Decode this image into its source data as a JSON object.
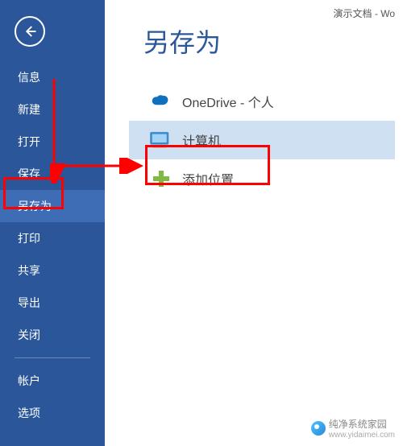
{
  "titlebar": {
    "text": "演示文档 - Wo"
  },
  "sidebar": {
    "items": [
      {
        "label": "信息"
      },
      {
        "label": "新建"
      },
      {
        "label": "打开"
      },
      {
        "label": "保存"
      },
      {
        "label": "另存为",
        "selected": true
      },
      {
        "label": "打印"
      },
      {
        "label": "共享"
      },
      {
        "label": "导出"
      },
      {
        "label": "关闭"
      }
    ],
    "footer_items": [
      {
        "label": "帐户"
      },
      {
        "label": "选项"
      }
    ]
  },
  "main": {
    "heading": "另存为",
    "options": [
      {
        "icon": "onedrive-icon",
        "label": "OneDrive - 个人"
      },
      {
        "icon": "computer-icon",
        "label": "计算机",
        "selected": true
      },
      {
        "icon": "add-icon",
        "label": "添加位置"
      }
    ]
  },
  "watermark": {
    "name": "纯净系统家园",
    "url": "www.yidaimei.com"
  }
}
